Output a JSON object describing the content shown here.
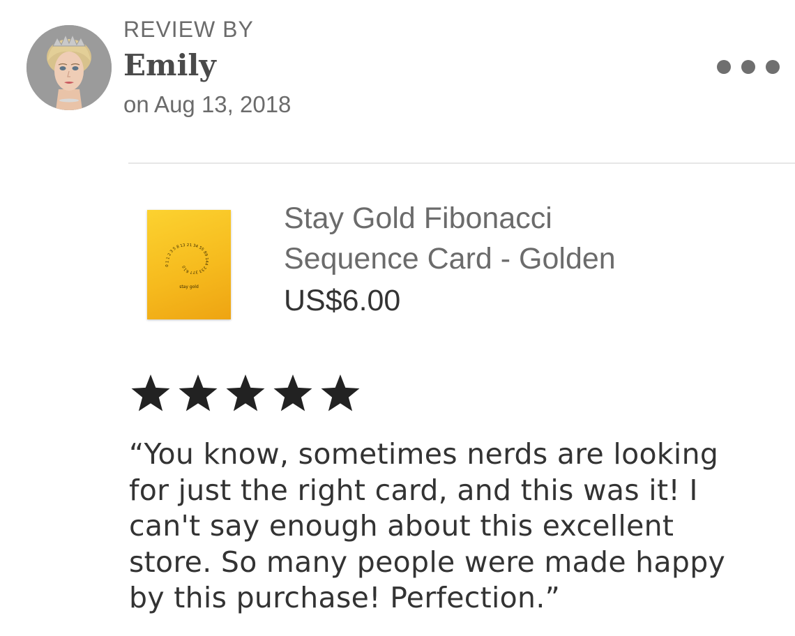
{
  "review": {
    "header_label": "REVIEW BY",
    "reviewer_name": "Emily",
    "date": "on Aug 13, 2018",
    "rating_value": 5,
    "rating_max": 5,
    "text_lines": [
      "“You know, sometimes nerds are looking",
      "for just the right card, and this was it!  I",
      "can't say enough about this excellent",
      "store.  So many people were made happy",
      "by this purchase!  Perfection.”"
    ]
  },
  "product": {
    "title_lines": [
      "Stay Gold Fibonacci",
      "Sequence Card - Golden"
    ],
    "price": "US$6.00",
    "thumb_text": "stay gold",
    "thumb_numbers": "0 1 1 2 3 5 8 13 21 34 55 89 144 233 377 610"
  },
  "icons": {
    "more": "more-horizontal-icon",
    "star": "star-icon",
    "avatar": "avatar-image"
  },
  "colors": {
    "star": "#222222",
    "card_gold": "#f6bb1e",
    "text_muted": "#6b6b6b",
    "divider": "#e6e6e6"
  }
}
